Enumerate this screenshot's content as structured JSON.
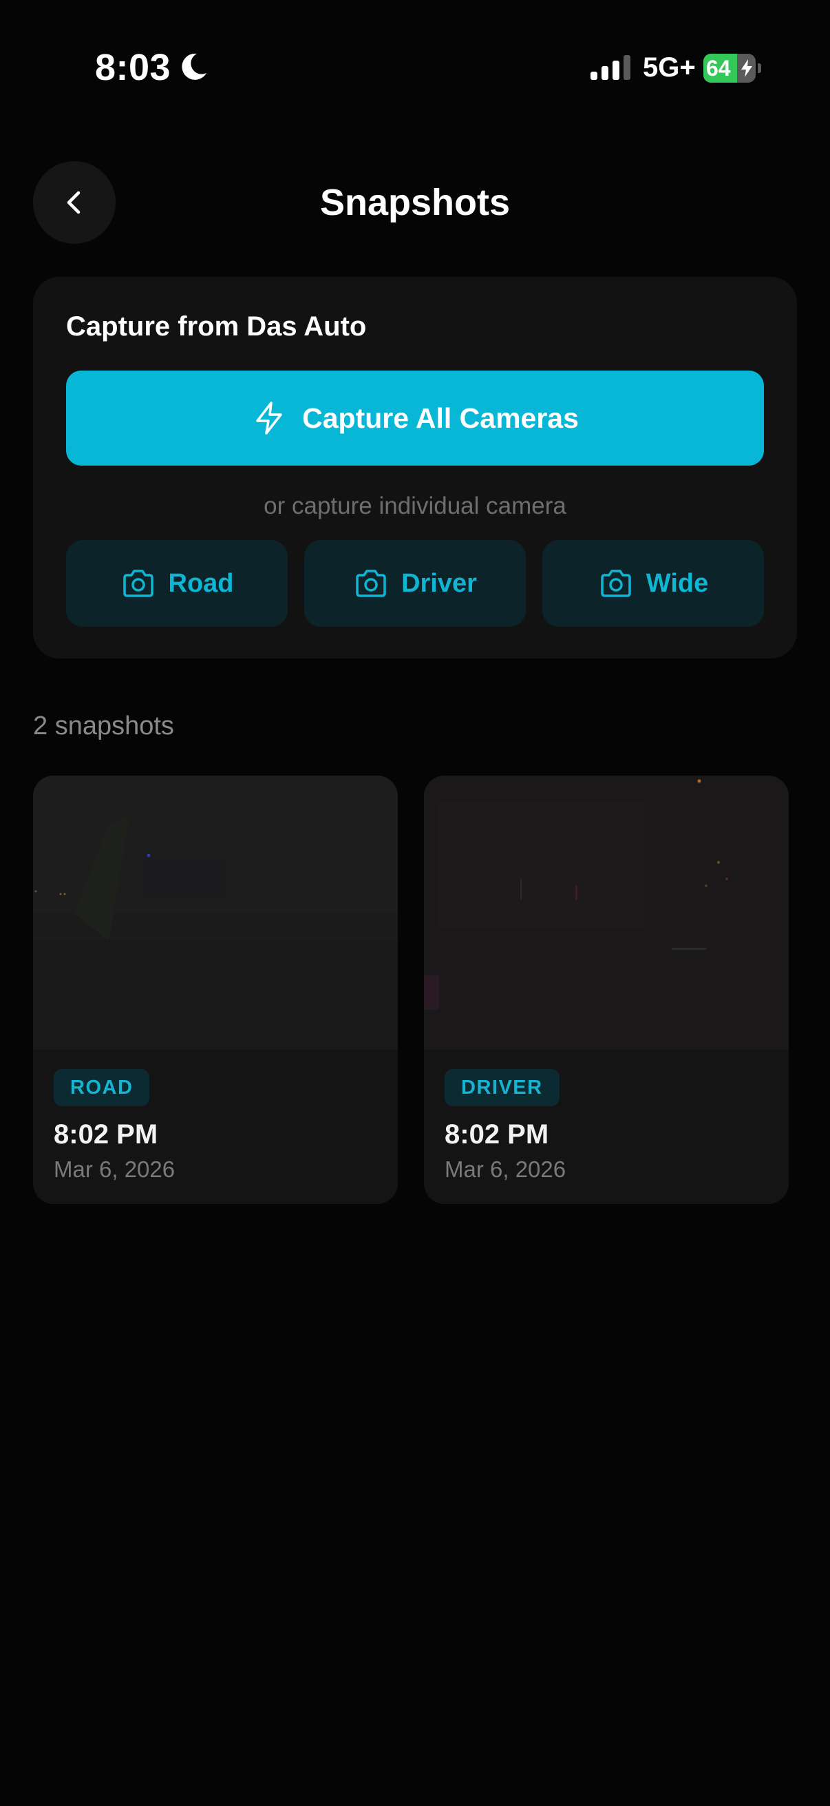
{
  "status_bar": {
    "time": "8:03",
    "network": "5G+",
    "battery_percent": "64",
    "battery_level": 0.64,
    "icons": [
      "moon-icon",
      "cellular-signal-icon",
      "battery-charging-icon"
    ]
  },
  "header": {
    "title": "Snapshots",
    "back_icon": "chevron-left-icon"
  },
  "capture": {
    "heading": "Capture from Das Auto",
    "capture_all_label": "Capture All Cameras",
    "capture_all_icon": "lightning-bolt-icon",
    "hint": "or capture individual camera",
    "cameras": [
      {
        "label": "Road",
        "icon": "camera-icon"
      },
      {
        "label": "Driver",
        "icon": "camera-icon"
      },
      {
        "label": "Wide",
        "icon": "camera-icon"
      }
    ]
  },
  "snapshots": {
    "count_label": "2 snapshots",
    "items": [
      {
        "badge": "ROAD",
        "time": "8:02 PM",
        "date": "Mar 6, 2026"
      },
      {
        "badge": "DRIVER",
        "time": "8:02 PM",
        "date": "Mar 6, 2026"
      }
    ]
  },
  "colors": {
    "background": "#050505",
    "card": "#121212",
    "accent": "#08b7d6",
    "camera_button_bg": "#0c2329",
    "badge_bg": "#0c2a31",
    "battery_green": "#34c759"
  }
}
